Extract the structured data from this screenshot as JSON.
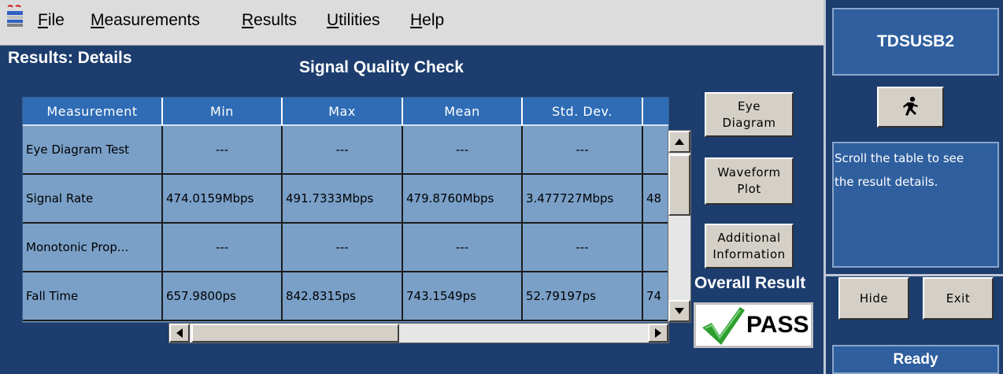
{
  "menu": {
    "items": [
      {
        "mnemonic": "F",
        "rest": "ile"
      },
      {
        "mnemonic": "M",
        "rest": "easurements"
      },
      {
        "mnemonic": "R",
        "rest": "esults"
      },
      {
        "mnemonic": "U",
        "rest": "tilities"
      },
      {
        "mnemonic": "H",
        "rest": "elp"
      }
    ]
  },
  "header": {
    "left_title": "Results: Details",
    "center_title": "Signal Quality Check"
  },
  "table": {
    "columns": [
      "Measurement",
      "Min",
      "Max",
      "Mean",
      "Std. Dev.",
      ""
    ],
    "rows": [
      [
        "Eye Diagram Test",
        "---",
        "---",
        "---",
        "---",
        ""
      ],
      [
        "Signal Rate",
        "474.0159Mbps",
        "491.7333Mbps",
        "479.8760Mbps",
        "3.477727Mbps",
        "48"
      ],
      [
        "Monotonic Prop...",
        "---",
        "---",
        "---",
        "---",
        ""
      ],
      [
        "Fall Time",
        "657.9800ps",
        "842.8315ps",
        "743.1549ps",
        "52.79197ps",
        "74"
      ]
    ]
  },
  "buttons": {
    "eye_line1": "Eye",
    "eye_line2": "Diagram",
    "wave_line1": "Waveform",
    "wave_line2": "Plot",
    "add_line1": "Additional",
    "add_line2": "Information",
    "hide": "Hide",
    "exit": "Exit"
  },
  "result": {
    "label": "Overall Result",
    "value": "PASS",
    "color": "#2e9e2e"
  },
  "side": {
    "title": "TDSUSB2",
    "message_line1": "Scroll the table to see",
    "message_line2": "the result details.",
    "status": "Ready"
  },
  "colors": {
    "background": "#1c3d6e",
    "header_cell": "#2f6cb5",
    "table_cell": "#7aa0c8",
    "panel": "#2f5f9e"
  }
}
